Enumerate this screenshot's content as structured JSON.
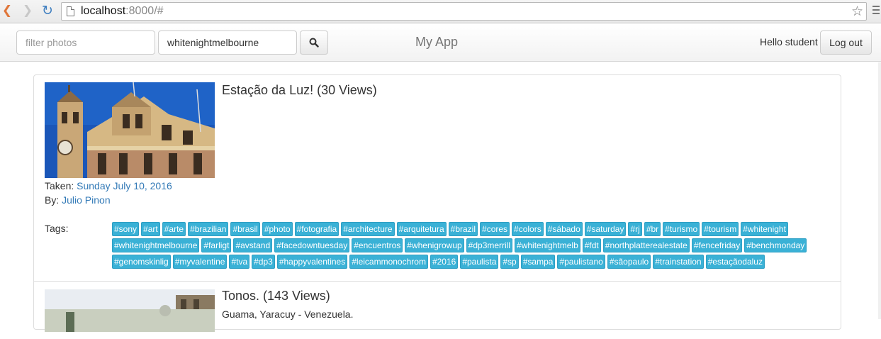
{
  "browser": {
    "url_host": "localhost",
    "url_rest": ":8000/#"
  },
  "navbar": {
    "filter_placeholder": "filter photos",
    "tag_value": "whitenightmelbourne",
    "brand": "My App",
    "hello": "Hello student",
    "logout_label": "Log out"
  },
  "photos": [
    {
      "title": "Estação da Luz! (30 Views)",
      "taken_label": "Taken:",
      "taken_date": "Sunday July 10, 2016",
      "by_label": "By:",
      "author": "Julio Pinon",
      "tags_label": "Tags:",
      "tags": [
        "#sony",
        "#art",
        "#arte",
        "#brazilian",
        "#brasil",
        "#photo",
        "#fotografia",
        "#architecture",
        "#arquitetura",
        "#brazil",
        "#cores",
        "#colors",
        "#sábado",
        "#saturday",
        "#rj",
        "#br",
        "#turismo",
        "#tourism",
        "#whitenight",
        "#whitenightmelbourne",
        "#farligt",
        "#avstand",
        "#facedowntuesday",
        "#encuentros",
        "#whenigrowup",
        "#dp3merrill",
        "#whitenightmelb",
        "#fdt",
        "#northplatterealestate",
        "#fencefriday",
        "#benchmonday",
        "#genomskinlig",
        "#myvalentine",
        "#tva",
        "#dp3",
        "#happyvalentines",
        "#leicammonochrom",
        "#2016",
        "#paulista",
        "#sp",
        "#sampa",
        "#paulistano",
        "#sãopaulo",
        "#trainstation",
        "#estaçãodaluz"
      ]
    },
    {
      "title": "Tonos. (143 Views)",
      "description": "Guama, Yaracuy - Venezuela."
    }
  ]
}
